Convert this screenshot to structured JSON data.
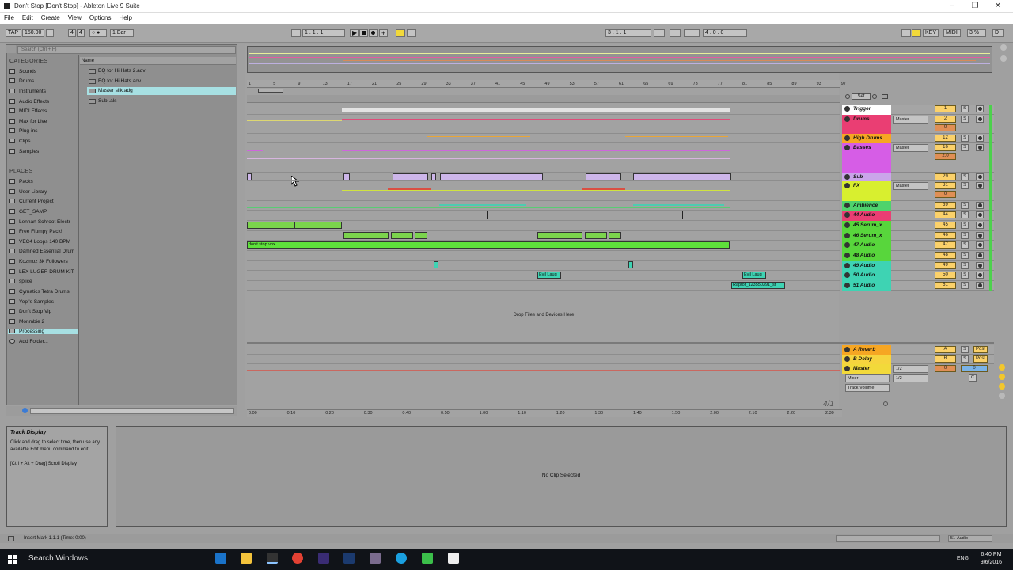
{
  "window": {
    "title": "Don't Stop  [Don't Stop] - Ableton Live 9 Suite",
    "minimize": "–",
    "restore": "❐",
    "close": "✕"
  },
  "menu": [
    "File",
    "Edit",
    "Create",
    "View",
    "Options",
    "Help"
  ],
  "transport": {
    "tap": "TAP",
    "tempo": "150.00",
    "time_sig_num": "4",
    "time_sig_den": "4",
    "metronome": "○ ●",
    "quantize": "1 Bar",
    "position": "1 .   1 .   1",
    "loop_start": "3 .   1 .   1",
    "loop_length": "4 .   0 .   0",
    "key": "KEY",
    "midi": "MIDI",
    "cpu": "3 %",
    "disk": "D"
  },
  "browser": {
    "search_placeholder": "Search (Ctrl + F)",
    "categories_title": "CATEGORIES",
    "categories": [
      "Sounds",
      "Drums",
      "Instruments",
      "Audio Effects",
      "MIDI Effects",
      "Max for Live",
      "Plug-ins",
      "Clips",
      "Samples"
    ],
    "places_title": "PLACES",
    "places": [
      "Packs",
      "User Library",
      "Current Project",
      "GET_SAMP",
      "Lennart Schroot Electr",
      "Free Flumpy Pack!",
      "VEC4 Loops 140 BPM",
      "Damned Essential Drum",
      "Kozmoz 3k Followers",
      "LEX LUGER DRUM KIT",
      "splice",
      "Cymatics Tetra Drums",
      "Yepi's Samples",
      "Don't Stop Vip",
      "Monmbie 2",
      "Processing"
    ],
    "selected_place": "Processing",
    "add_folder": "Add Folder...",
    "name_header": "Name",
    "files": [
      {
        "name": "EQ for Hi Hats 2.adv"
      },
      {
        "name": "EQ for Hi Hats.adv"
      },
      {
        "name": "Master silk.adg",
        "selected": true
      },
      {
        "name": "Sub .als"
      }
    ]
  },
  "ruler": [
    "1",
    "5",
    "9",
    "13",
    "17",
    "21",
    "25",
    "29",
    "33",
    "37",
    "41",
    "45",
    "49",
    "53",
    "57",
    "61",
    "65",
    "69",
    "73",
    "77",
    "81",
    "85",
    "89",
    "93",
    "97"
  ],
  "timeline": [
    "0:00",
    "0:10",
    "0:20",
    "0:30",
    "0:40",
    "0:50",
    "1:00",
    "1:10",
    "1:20",
    "1:30",
    "1:40",
    "1:50",
    "2:00",
    "2:10",
    "2:20",
    "2:30"
  ],
  "tracks": [
    {
      "name": "Trigger",
      "color": "#ffffff",
      "num": "1"
    },
    {
      "name": "Drums",
      "color": "#ea3e73",
      "num": "2",
      "route": "Master",
      "vol": "0"
    },
    {
      "name": "High Drums",
      "color": "#f6a623",
      "num": "12"
    },
    {
      "name": "Basses",
      "color": "#d65de6",
      "num": "16",
      "route": "Master",
      "vol": "2.0"
    },
    {
      "name": "Sub",
      "color": "#caa5ea",
      "num": "29"
    },
    {
      "name": "FX",
      "color": "#d8ef2f",
      "num": "31",
      "route": "Master",
      "vol": "0"
    },
    {
      "name": "Ambience",
      "color": "#4ed36c",
      "num": "39"
    },
    {
      "name": "44 Audio",
      "color": "#ea3e73",
      "num": "44"
    },
    {
      "name": "45 Serum_x",
      "color": "#58d63c",
      "num": "45"
    },
    {
      "name": "46 Serum_x",
      "color": "#58d63c",
      "num": "46"
    },
    {
      "name": "47 Audio",
      "color": "#58d63c",
      "num": "47"
    },
    {
      "name": "48 Audio",
      "color": "#58d63c",
      "num": "48"
    },
    {
      "name": "49 Audio",
      "color": "#3ed3b3",
      "num": "49"
    },
    {
      "name": "50 Audio",
      "color": "#3ed3b3",
      "num": "50"
    },
    {
      "name": "51 Audio",
      "color": "#3ed3b3",
      "num": "51"
    }
  ],
  "clips": {
    "vox": "don't stop vox",
    "evil1": "Evil Laug",
    "evil2": "Evil Laug",
    "raptor": "Raptor_123550391_st"
  },
  "drop_text": "Drop Files and Devices Here",
  "returns": [
    {
      "name": "A Reverb",
      "letter": "A",
      "color": "#f6a623"
    },
    {
      "name": "B Delay",
      "letter": "B",
      "color": "#f6d43e"
    }
  ],
  "master": {
    "name": "Master",
    "route": "1/2",
    "route2": "1/2",
    "mixer": "Mixer",
    "track_volume": "Track Volume",
    "post": "Post"
  },
  "page_indicator": "4/1",
  "set_label": "Set",
  "info": {
    "title": "Track Display",
    "body": "Click and drag to select time, then use any available Edit menu command to edit.",
    "hint": "[Ctrl + Alt + Drag] Scroll Display"
  },
  "no_clip": "No Clip Selected",
  "status_left": "Insert Mark 1.1.1 (Time: 0:00)",
  "status_right": "51-Audio",
  "taskbar": {
    "search": "Search Windows",
    "time": "6:40 PM",
    "date": "9/6/2016",
    "lang": "ENG"
  }
}
